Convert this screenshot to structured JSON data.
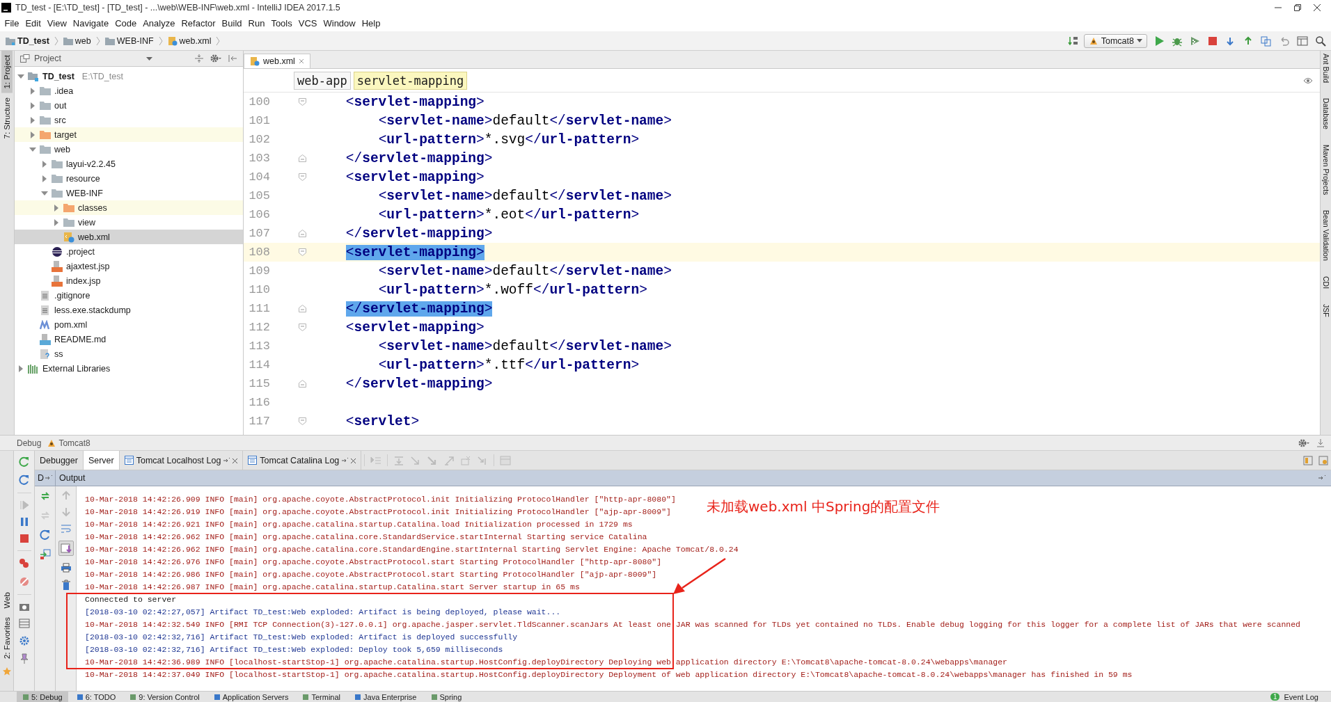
{
  "window": {
    "title": "TD_test - [E:\\TD_test] - [TD_test] - ...\\web\\WEB-INF\\web.xml - IntelliJ IDEA 2017.1.5"
  },
  "menu": [
    "File",
    "Edit",
    "View",
    "Navigate",
    "Code",
    "Analyze",
    "Refactor",
    "Build",
    "Run",
    "Tools",
    "VCS",
    "Window",
    "Help"
  ],
  "nav_bar": {
    "breadcrumbs": [
      {
        "label": "TD_test",
        "kind": "module"
      },
      {
        "label": "web",
        "kind": "folder"
      },
      {
        "label": "WEB-INF",
        "kind": "folder"
      },
      {
        "label": "web.xml",
        "kind": "xml"
      }
    ],
    "run_config": "Tomcat8"
  },
  "left_strip": [
    {
      "label": "1: Project",
      "selected": true
    },
    {
      "label": "7: Structure",
      "selected": false
    }
  ],
  "left_strip_bottom": [
    {
      "label": "Web",
      "selected": false
    },
    {
      "label": "2: Favorites",
      "selected": false
    }
  ],
  "right_strip": [
    "Ant Build",
    "Database",
    "Maven Projects",
    "Bean Validation",
    "CDI",
    "JSF"
  ],
  "project": {
    "title": "Project",
    "tree": [
      {
        "label": "TD_test",
        "path": "E:\\TD_test",
        "kind": "module",
        "expanded": true,
        "selected": false,
        "children": [
          {
            "label": ".idea",
            "kind": "folder",
            "expanded": false,
            "selected": false
          },
          {
            "label": "out",
            "kind": "folder",
            "expanded": false,
            "selected": false
          },
          {
            "label": "src",
            "kind": "folder",
            "expanded": false,
            "selected": false
          },
          {
            "label": "target",
            "kind": "excluded-folder",
            "expanded": false,
            "selected": false
          },
          {
            "label": "web",
            "kind": "folder",
            "expanded": true,
            "selected": false,
            "children": [
              {
                "label": "layui-v2.2.45",
                "kind": "folder",
                "expanded": false,
                "selected": false
              },
              {
                "label": "resource",
                "kind": "folder",
                "expanded": false,
                "selected": false
              },
              {
                "label": "WEB-INF",
                "kind": "folder",
                "expanded": true,
                "selected": false,
                "children": [
                  {
                    "label": "classes",
                    "kind": "excluded-folder",
                    "expanded": false,
                    "selected": false
                  },
                  {
                    "label": "view",
                    "kind": "folder",
                    "expanded": false,
                    "selected": false
                  },
                  {
                    "label": "web.xml",
                    "kind": "xml",
                    "selected": true
                  }
                ]
              },
              {
                "label": ".project",
                "kind": "eclipse",
                "selected": false
              },
              {
                "label": "ajaxtest.jsp",
                "kind": "jsp",
                "selected": false
              },
              {
                "label": "index.jsp",
                "kind": "jsp",
                "selected": false
              }
            ]
          },
          {
            "label": ".gitignore",
            "kind": "text",
            "selected": false
          },
          {
            "label": "less.exe.stackdump",
            "kind": "text",
            "selected": false
          },
          {
            "label": "pom.xml",
            "kind": "maven",
            "selected": false
          },
          {
            "label": "README.md",
            "kind": "markdown",
            "selected": false
          },
          {
            "label": "ss",
            "kind": "unknown",
            "selected": false
          }
        ]
      },
      {
        "label": "External Libraries",
        "kind": "libraries",
        "expanded": false,
        "selected": false
      }
    ]
  },
  "editor": {
    "tabs": [
      {
        "label": "web.xml",
        "selected": true
      }
    ],
    "breadcrumbs": [
      {
        "label": "web-app",
        "selected": false
      },
      {
        "label": "servlet-mapping",
        "selected": true
      }
    ],
    "lines": [
      {
        "number": "100",
        "code": "    <servlet-mapping>",
        "kind": "fold-start",
        "current": false,
        "selected": false
      },
      {
        "number": "101",
        "code": "        <servlet-name>default</servlet-name>",
        "kind": "plain",
        "current": false,
        "selected": false
      },
      {
        "number": "102",
        "code": "        <url-pattern>*.svg</url-pattern>",
        "kind": "plain",
        "current": false,
        "selected": false
      },
      {
        "number": "103",
        "code": "    </servlet-mapping>",
        "kind": "fold-end",
        "current": false,
        "selected": false
      },
      {
        "number": "104",
        "code": "    <servlet-mapping>",
        "kind": "fold-start",
        "current": false,
        "selected": false
      },
      {
        "number": "105",
        "code": "        <servlet-name>default</servlet-name>",
        "kind": "plain",
        "current": false,
        "selected": false
      },
      {
        "number": "106",
        "code": "        <url-pattern>*.eot</url-pattern>",
        "kind": "plain",
        "current": false,
        "selected": false
      },
      {
        "number": "107",
        "code": "    </servlet-mapping>",
        "kind": "fold-end",
        "current": false,
        "selected": false
      },
      {
        "number": "108",
        "code": "    <servlet-mapping>",
        "kind": "fold-start",
        "current": true,
        "selected": true
      },
      {
        "number": "109",
        "code": "        <servlet-name>default</servlet-name>",
        "kind": "plain",
        "current": false,
        "selected": false
      },
      {
        "number": "110",
        "code": "        <url-pattern>*.woff</url-pattern>",
        "kind": "plain",
        "current": false,
        "selected": false
      },
      {
        "number": "111",
        "code": "    </servlet-mapping>",
        "kind": "fold-end",
        "current": false,
        "selected": true
      },
      {
        "number": "112",
        "code": "    <servlet-mapping>",
        "kind": "fold-start",
        "current": false,
        "selected": false
      },
      {
        "number": "113",
        "code": "        <servlet-name>default</servlet-name>",
        "kind": "plain",
        "current": false,
        "selected": false
      },
      {
        "number": "114",
        "code": "        <url-pattern>*.ttf</url-pattern>",
        "kind": "plain",
        "current": false,
        "selected": false
      },
      {
        "number": "115",
        "code": "    </servlet-mapping>",
        "kind": "fold-end",
        "current": false,
        "selected": false
      },
      {
        "number": "116",
        "kind": "plain",
        "current": false
      },
      {
        "number": "117",
        "code": "    <servlet>",
        "kind": "fold-start",
        "current": false,
        "selected": false
      }
    ]
  },
  "debug": {
    "title": "Debug",
    "config": "Tomcat8",
    "tabs": [
      {
        "label": "Debugger",
        "kind": "plain",
        "selected": false
      },
      {
        "label": "Server",
        "kind": "plain",
        "selected": true
      },
      {
        "label": "Tomcat Localhost Log",
        "kind": "log",
        "selected": false
      },
      {
        "label": "Tomcat Catalina Log",
        "kind": "log",
        "selected": false
      }
    ],
    "output_header": {
      "column_1": "D",
      "title": "Output"
    },
    "log": [
      {
        "kind": "info",
        "text": "10-Mar-2018 14:42:26.909 INFO [main] org.apache.coyote.AbstractProtocol.init Initializing ProtocolHandler [\"http-apr-8080\"]"
      },
      {
        "kind": "info",
        "text": "10-Mar-2018 14:42:26.919 INFO [main] org.apache.coyote.AbstractProtocol.init Initializing ProtocolHandler [\"ajp-apr-8009\"]"
      },
      {
        "kind": "info",
        "text": "10-Mar-2018 14:42:26.921 INFO [main] org.apache.catalina.startup.Catalina.load Initialization processed in 1729 ms"
      },
      {
        "kind": "info",
        "text": "10-Mar-2018 14:42:26.962 INFO [main] org.apache.catalina.core.StandardService.startInternal Starting service Catalina"
      },
      {
        "kind": "info",
        "text": "10-Mar-2018 14:42:26.962 INFO [main] org.apache.catalina.core.StandardEngine.startInternal Starting Servlet Engine: Apache Tomcat/8.0.24"
      },
      {
        "kind": "info",
        "text": "10-Mar-2018 14:42:26.976 INFO [main] org.apache.coyote.AbstractProtocol.start Starting ProtocolHandler [\"http-apr-8080\"]"
      },
      {
        "kind": "info",
        "text": "10-Mar-2018 14:42:26.986 INFO [main] org.apache.coyote.AbstractProtocol.start Starting ProtocolHandler [\"ajp-apr-8009\"]"
      },
      {
        "kind": "info",
        "text": "10-Mar-2018 14:42:26.987 INFO [main] org.apache.catalina.startup.Catalina.start Server startup in 65 ms"
      },
      {
        "kind": "system",
        "text": "Connected to server"
      },
      {
        "kind": "artifact",
        "text": "[2018-03-10 02:42:27,057] Artifact TD_test:Web exploded: Artifact is being deployed, please wait..."
      },
      {
        "kind": "info",
        "text": "10-Mar-2018 14:42:32.549 INFO [RMI TCP Connection(3)-127.0.0.1] org.apache.jasper.servlet.TldScanner.scanJars At least one JAR was scanned for TLDs yet contained no TLDs. Enable debug logging for this logger for a complete list of JARs that were scanned"
      },
      {
        "kind": "artifact",
        "text": "[2018-03-10 02:42:32,716] Artifact TD_test:Web exploded: Artifact is deployed successfully"
      },
      {
        "kind": "artifact",
        "text": "[2018-03-10 02:42:32,716] Artifact TD_test:Web exploded: Deploy took 5,659 milliseconds"
      },
      {
        "kind": "info",
        "text": "10-Mar-2018 14:42:36.989 INFO [localhost-startStop-1] org.apache.catalina.startup.HostConfig.deployDirectory Deploying web application directory E:\\Tomcat8\\apache-tomcat-8.0.24\\webapps\\manager"
      },
      {
        "kind": "info",
        "text": "10-Mar-2018 14:42:37.049 INFO [localhost-startStop-1] org.apache.catalina.startup.HostConfig.deployDirectory Deployment of web application directory E:\\Tomcat8\\apache-tomcat-8.0.24\\webapps\\manager has finished in 59 ms"
      }
    ],
    "annotation": {
      "text": "未加载web.xml 中Spring的配置文件"
    }
  },
  "bottom_bar": {
    "tabs": [
      {
        "label": "5: Debug",
        "selected": true
      },
      {
        "label": "6: TODO",
        "selected": false
      },
      {
        "label": "9: Version Control",
        "selected": false
      },
      {
        "label": "Application Servers",
        "selected": false
      },
      {
        "label": "Terminal",
        "selected": false
      },
      {
        "label": "Java Enterprise",
        "selected": false
      },
      {
        "label": "Spring",
        "selected": false
      }
    ],
    "event_log": {
      "label": "Event Log",
      "badge": "1"
    }
  }
}
